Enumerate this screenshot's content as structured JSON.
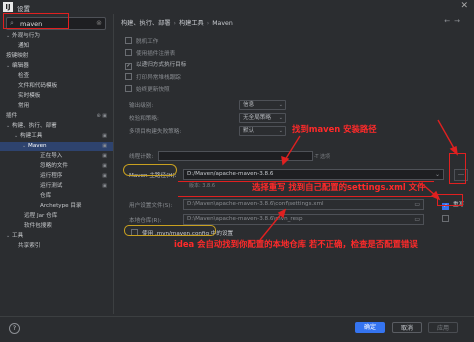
{
  "window": {
    "title": "设置",
    "app_icon": "IJ"
  },
  "search": {
    "value": "maven"
  },
  "sidebar": {
    "items": [
      {
        "label": "外观与行为",
        "caret": "⌄"
      },
      {
        "label": "通知"
      },
      {
        "label": "按键映射"
      },
      {
        "label": "编辑器",
        "caret": "⌄"
      },
      {
        "label": "检查"
      },
      {
        "label": "文件和代码模板"
      },
      {
        "label": "实时模板"
      },
      {
        "label": "常用"
      },
      {
        "label": "插件"
      },
      {
        "label": "构建、执行、部署",
        "caret": "⌄"
      },
      {
        "label": "构建工具",
        "caret": "⌄"
      },
      {
        "label": "Maven",
        "caret": "⌄"
      },
      {
        "label": "正在导入"
      },
      {
        "label": "忽略的文件"
      },
      {
        "label": "运行程序"
      },
      {
        "label": "运行测试"
      },
      {
        "label": "仓库"
      },
      {
        "label": "Archetype 目录"
      },
      {
        "label": "远程 Jar 仓库"
      },
      {
        "label": "软件包搜索"
      },
      {
        "label": "工具",
        "caret": "⌄"
      },
      {
        "label": "共享索引"
      }
    ]
  },
  "breadcrumb": [
    "构建、执行、部署",
    "构建工具",
    "Maven"
  ],
  "content": {
    "checkboxes": [
      {
        "label": "脱机工作",
        "checked": false
      },
      {
        "label": "使用插件注册表",
        "checked": false
      },
      {
        "label": "以递归方式执行目标",
        "checked": true
      },
      {
        "label": "打印异常堆栈跟踪",
        "checked": false
      },
      {
        "label": "始终更新快照",
        "checked": false
      }
    ],
    "output_level": {
      "label": "输出级别:",
      "value": "信息"
    },
    "checksum_policy": {
      "label": "校验和策略:",
      "value": "无全局策略"
    },
    "multiproject_build": {
      "label": "多项目构建失败策略:",
      "value": "默认"
    },
    "threads": {
      "label": "线程计数:",
      "hint": "-T 选项"
    },
    "maven_home": {
      "label": "Maven 主路径(H):",
      "value": "D:/Maven/apache-maven-3.8.6",
      "version": "版本: 3.8.6"
    },
    "user_settings": {
      "label": "用户设置文件(S):",
      "value": "D:\\Maven\\apache-maven-3.8.6\\conf\\settings.xml",
      "override_label": "重写",
      "override_checked": true
    },
    "local_repo": {
      "label": "本地仓库(R):",
      "value": "D:\\Maven\\apache-maven-3.8.6\\mvn_resp"
    },
    "mvn_config": {
      "label": "使用 .mvn/maven.config 中的设置",
      "checked": false
    }
  },
  "annotations": {
    "find_maven": "找到maven 安装路径",
    "override_settings": "选择重写 找到自己配置的settings.xml 文件",
    "idea_repo": "idea 会自动找到你配置的本地仓库 若不正确，检查是否配置错误"
  },
  "footer": {
    "help": "?",
    "ok": "确定",
    "cancel": "取消",
    "apply": "应用"
  }
}
